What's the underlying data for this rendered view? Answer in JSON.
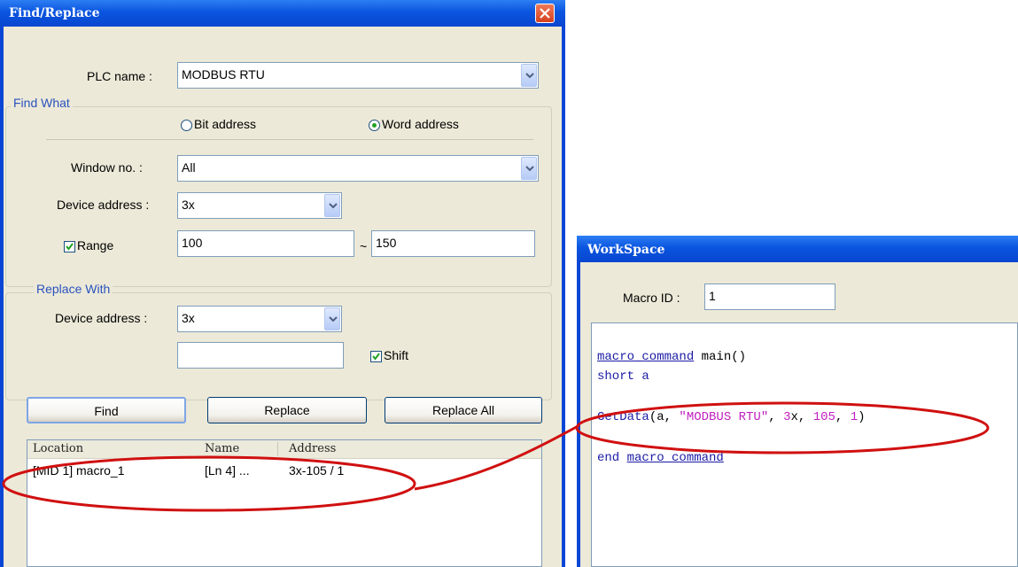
{
  "find_replace": {
    "title": "Find/Replace",
    "plc_name_label": "PLC name :",
    "plc_name_value": "MODBUS RTU",
    "find_what": {
      "group_label": "Find What",
      "bit_address_label": "Bit address",
      "word_address_label": "Word address",
      "selected": "word",
      "window_no_label": "Window no. :",
      "window_no_value": "All",
      "device_address_label": "Device address :",
      "device_address_value": "3x",
      "range_label": "Range",
      "range_checked": true,
      "range_from": "100",
      "range_tilde": "~",
      "range_to": "150"
    },
    "replace_with": {
      "group_label": "Replace With",
      "device_address_label": "Device address :",
      "device_address_value": "3x",
      "address_value": "",
      "shift_label": "Shift",
      "shift_checked": true
    },
    "buttons": {
      "find": "Find",
      "replace": "Replace",
      "replace_all": "Replace All"
    },
    "results": {
      "columns": [
        "Location",
        "Name",
        "Address"
      ],
      "rows": [
        {
          "location": "[MID 1] macro_1",
          "name": "[Ln 4] ...",
          "address": "3x-105 / 1"
        }
      ]
    }
  },
  "workspace": {
    "title": "WorkSpace",
    "macro_id_label": "Macro ID :",
    "macro_id_value": "1",
    "code": {
      "line1_kw": "macro_command",
      "line1_rest": " main()",
      "line2": "short a",
      "line4_fn": "GetData",
      "line4_a": "(a, ",
      "line4_str": "\"MODBUS RTU\"",
      "line4_b": ", ",
      "line4_n1": "3",
      "line4_c": "x, ",
      "line4_n2": "105",
      "line4_d": ", ",
      "line4_n3": "1",
      "line4_e": ")",
      "line6_a": "end ",
      "line6_kw": "macro_command"
    }
  },
  "colors": {
    "title_bar": "#0a55e0",
    "dialog_bg": "#ece9d8",
    "annotation": "#d01010",
    "group_label": "#2a52be",
    "keyword": "#1a1aa6",
    "string_literal": "#c020c0"
  }
}
